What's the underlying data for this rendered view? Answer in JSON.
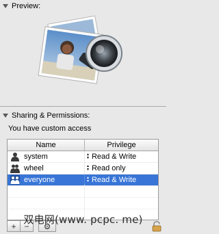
{
  "preview": {
    "title": "Preview:",
    "icon": "preview-app-icon"
  },
  "sharing": {
    "title": "Sharing & Permissions:",
    "access_text": "You have custom access",
    "table": {
      "columns": [
        "Name",
        "Privilege"
      ],
      "rows": [
        {
          "name": "system",
          "privilege": "Read & Write",
          "icon": "single-user-icon",
          "selected": false
        },
        {
          "name": "wheel",
          "privilege": "Read only",
          "icon": "group-icon",
          "selected": false
        },
        {
          "name": "everyone",
          "privilege": "Read & Write",
          "icon": "everyone-icon",
          "selected": true
        }
      ]
    }
  },
  "bottom": {
    "add_label": "+",
    "remove_label": "−",
    "action_label": "⚙",
    "lock_icon": "lock-icon"
  },
  "watermark": "双电网(www. pcpc. me)",
  "colors": {
    "selection": "#3875d7",
    "background": "#e8e8e8"
  }
}
